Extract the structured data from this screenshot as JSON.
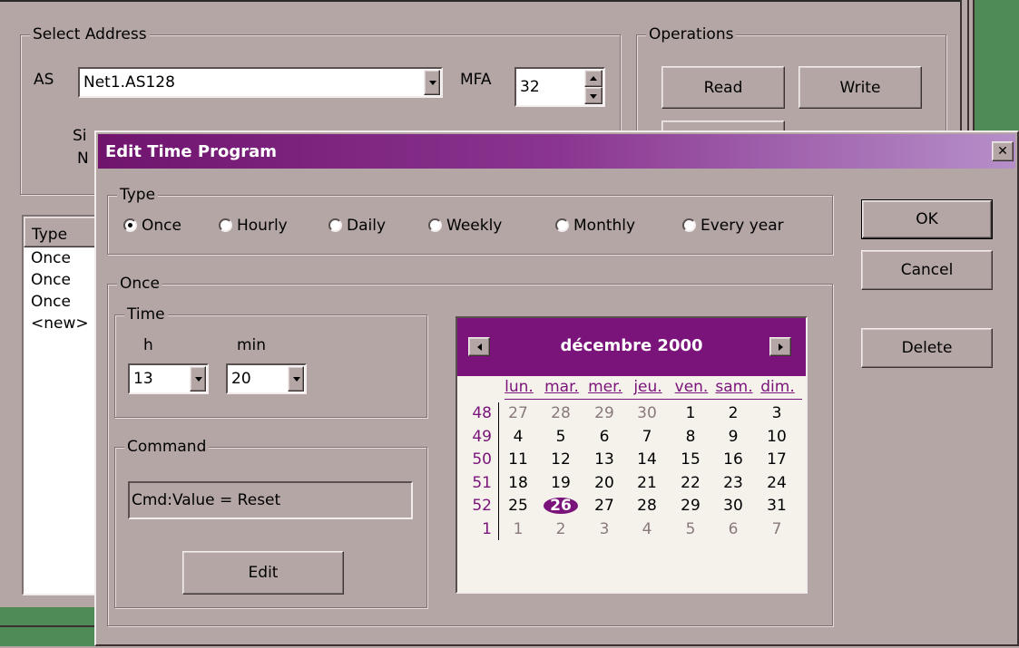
{
  "background": {
    "select_address": {
      "title": "Select Address",
      "as_label": "AS",
      "as_value": "Net1.AS128",
      "mfa_label": "MFA",
      "mfa_value": "32",
      "partial_label_1": "Si",
      "partial_label_2": "N"
    },
    "operations": {
      "title": "Operations",
      "read_label": "Read",
      "write_label": "Write"
    },
    "list": {
      "header": "Type",
      "rows": [
        "Once",
        "Once",
        "Once",
        "<new>"
      ]
    }
  },
  "dialog": {
    "title": "Edit Time Program",
    "close_glyph": "✕",
    "type_group": {
      "title": "Type",
      "options": [
        "Once",
        "Hourly",
        "Daily",
        "Weekly",
        "Monthly",
        "Every year"
      ],
      "selected": "Once"
    },
    "buttons": {
      "ok": "OK",
      "cancel": "Cancel",
      "delete": "Delete"
    },
    "once_group": {
      "title": "Once",
      "time": {
        "title": "Time",
        "h_label": "h",
        "min_label": "min",
        "h_value": "13",
        "min_value": "20"
      },
      "command": {
        "title": "Command",
        "value": "Cmd:Value = Reset",
        "edit_label": "Edit"
      }
    },
    "calendar": {
      "title": "décembre 2000",
      "weekdays": [
        "lun.",
        "mar.",
        "mer.",
        "jeu.",
        "ven.",
        "sam.",
        "dim."
      ],
      "weeks": [
        "48",
        "49",
        "50",
        "51",
        "52",
        "1"
      ],
      "days": [
        [
          "27",
          "28",
          "29",
          "30",
          "1",
          "2",
          "3"
        ],
        [
          "4",
          "5",
          "6",
          "7",
          "8",
          "9",
          "10"
        ],
        [
          "11",
          "12",
          "13",
          "14",
          "15",
          "16",
          "17"
        ],
        [
          "18",
          "19",
          "20",
          "21",
          "22",
          "23",
          "24"
        ],
        [
          "25",
          "26",
          "27",
          "28",
          "29",
          "30",
          "31"
        ],
        [
          "1",
          "2",
          "3",
          "4",
          "5",
          "6",
          "7"
        ]
      ],
      "selected_day": "26",
      "accent_color": "#7a137a",
      "other_month_color": "#8a7a7a"
    },
    "title_gradient": [
      "#70146e",
      "#b68fc9"
    ]
  }
}
